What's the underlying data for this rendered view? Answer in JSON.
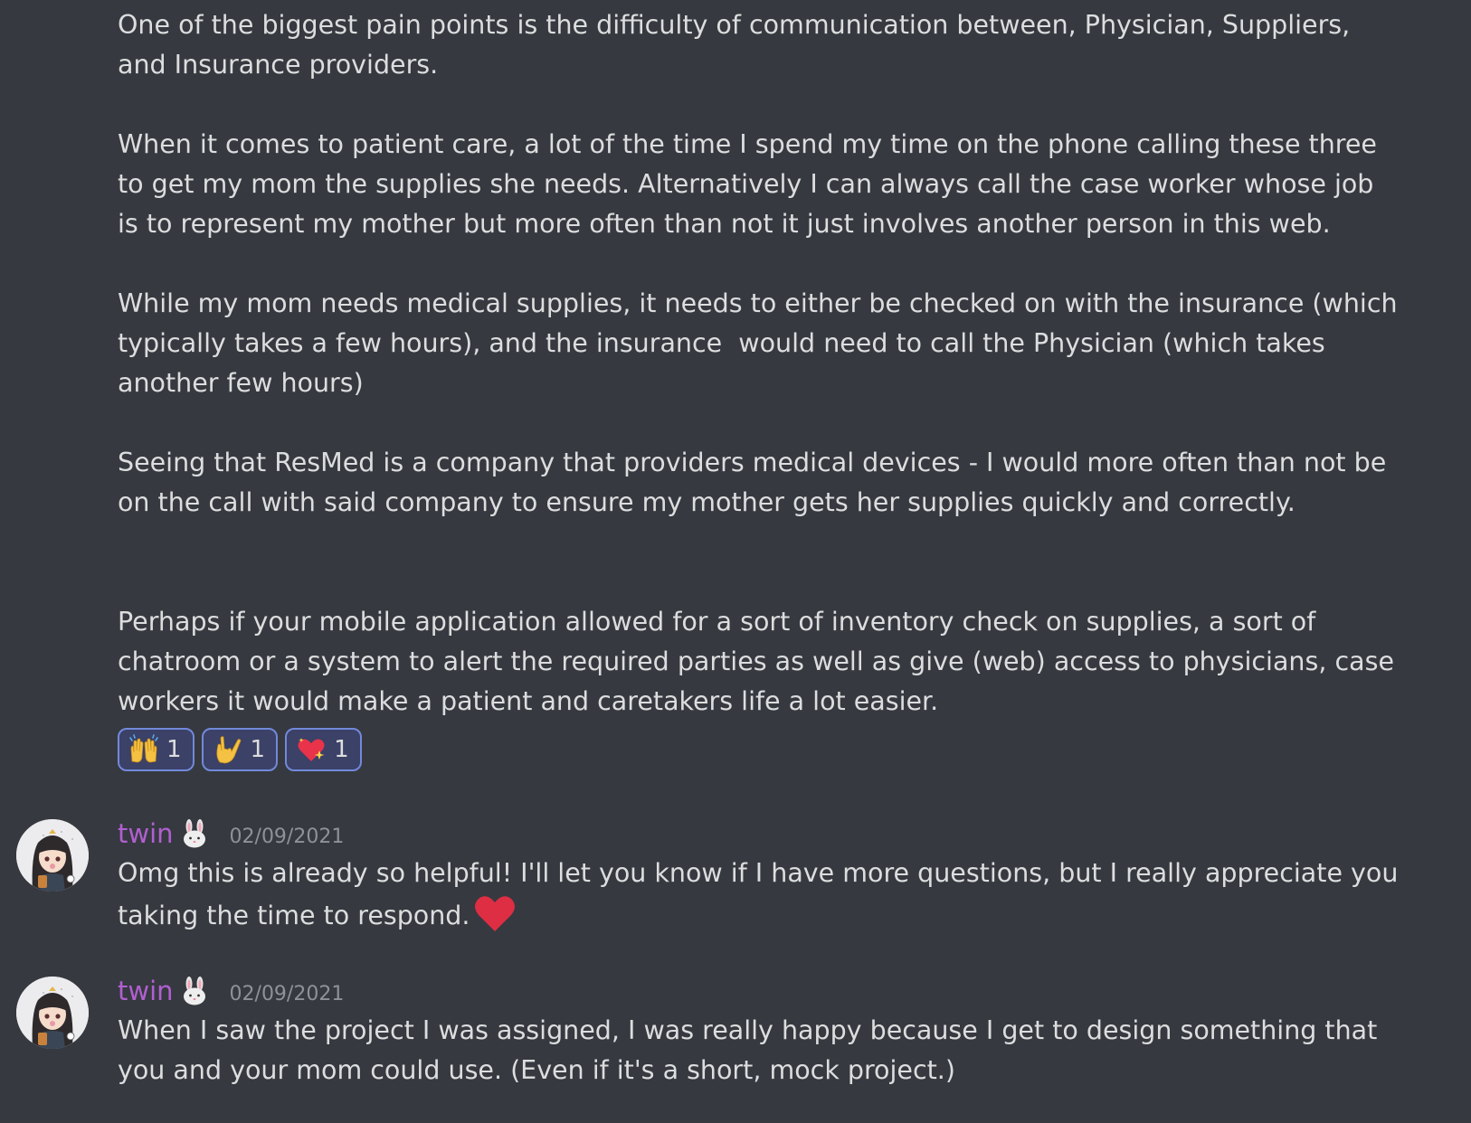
{
  "first_message": {
    "paragraphs": [
      "One of the biggest pain points is the difficulty of communication between, Physician, Suppliers, and Insurance providers.",
      "When it comes to patient care, a lot of the time I spend my time on the phone calling these three to get my mom the supplies she needs. Alternatively I can always call the case worker whose job is to represent my mother but more often than not it just involves another person in this web.",
      "While my mom needs medical supplies, it needs to either be checked on with the insurance (which typically takes a few hours), and the insurance  would need to call the Physician (which takes another few hours)",
      "Seeing that ResMed is a company that providers medical devices - I would more often than not be on the call with said company to ensure my mother gets her supplies quickly and correctly.",
      "Perhaps if your mobile application allowed for a sort of inventory check on supplies, a sort of chatroom or a system to alert the required parties as well as give (web) access to physicians, case workers it would make a patient and caretakers life a lot easier."
    ],
    "reactions": [
      {
        "emoji": "raising-hands",
        "count": "1"
      },
      {
        "emoji": "love-you-gesture",
        "count": "1"
      },
      {
        "emoji": "sparkling-heart",
        "count": "1"
      }
    ]
  },
  "messages": [
    {
      "username": "twin",
      "timestamp": "02/09/2021",
      "text": "Omg this is already so helpful! I'll let you know if I have more questions, but I really appreciate you taking the time to respond."
    },
    {
      "username": "twin",
      "timestamp": "02/09/2021",
      "text": "When I saw the project I was assigned, I was really happy because I get to design something that you and your mom could use. (Even if it's a short, mock project.)"
    }
  ],
  "colors": {
    "background": "#36393f",
    "text": "#dcddde",
    "username": "#b15fd1",
    "timestamp": "#8e9297",
    "reaction_border": "#7289da",
    "reaction_bg": "#3b4167"
  }
}
